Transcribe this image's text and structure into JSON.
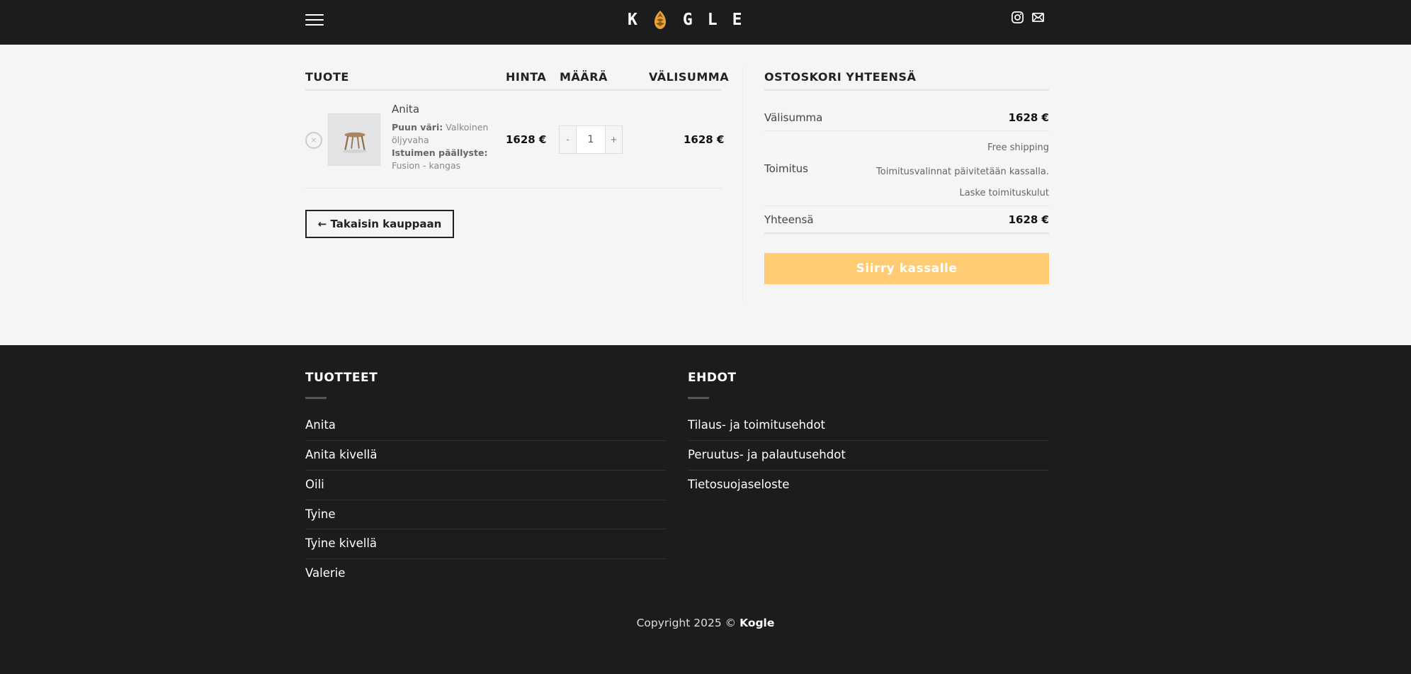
{
  "header": {
    "logo_letters": [
      "K",
      "G",
      "L",
      "E"
    ],
    "logo_text": "KOGLE",
    "menu_icon": "hamburger-icon",
    "social_icons": [
      "instagram-icon",
      "envelope-icon"
    ]
  },
  "cart": {
    "columns": {
      "product": "TUOTE",
      "price": "HINTA",
      "quantity": "MÄÄRÄ",
      "subtotal": "VÄLISUMMA"
    },
    "items": [
      {
        "remove": "×",
        "name": "Anita",
        "attr1_label": "Puun väri",
        "attr1_value": "Valkoinen öljyvaha",
        "attr2_label": "Istuimen päällyste",
        "attr2_value": "Fusion - kangas",
        "price": "1628 €",
        "qty_minus": "-",
        "qty": "1",
        "qty_plus": "+",
        "subtotal": "1628 €"
      }
    ],
    "back_button": "← Takaisin kauppaan"
  },
  "totals": {
    "heading": "OSTOSKORI YHTEENSÄ",
    "subtotal_label": "Välisumma",
    "subtotal_value": "1628 €",
    "shipping_label": "Toimitus",
    "shipping_free": "Free shipping",
    "shipping_note": "Toimitusvalinnat päivitetään kassalla.",
    "shipping_calc": "Laske toimituskulut",
    "total_label": "Yhteensä",
    "total_value": "1628 €",
    "checkout_button": "Siirry kassalle",
    "checkout_color": "#ffcc73"
  },
  "footer": {
    "products_heading": "TUOTTEET",
    "products": [
      "Anita",
      "Anita kivellä",
      "Oili",
      "Tyine",
      "Tyine kivellä",
      "Valerie"
    ],
    "terms_heading": "EHDOT",
    "terms": [
      "Tilaus- ja toimitusehdot",
      "Peruutus- ja palautusehdot",
      "Tietosuojaseloste"
    ],
    "copyright_prefix": "Copyright 2025 ©",
    "copyright_brand": "Kogle"
  },
  "colors": {
    "header_bg": "#1b1c1e",
    "page_bg": "#f5f5f5",
    "accent": "#e7a23a"
  }
}
